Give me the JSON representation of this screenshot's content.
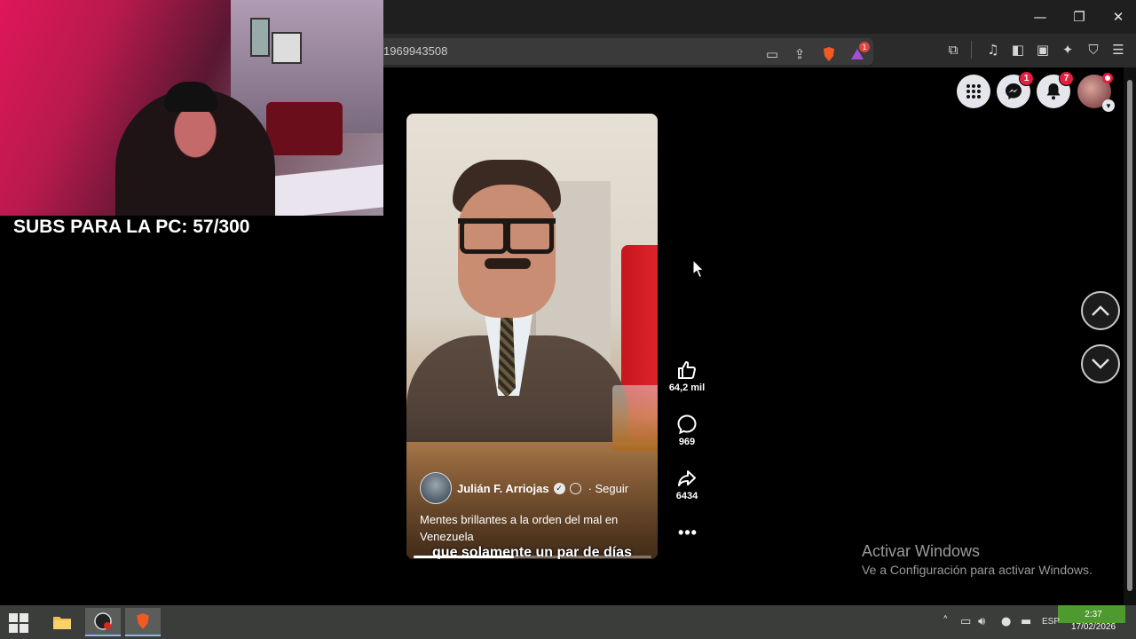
{
  "browser": {
    "url_fragment": "1969943508",
    "window_controls": {
      "minimize": "—",
      "maximize": "❐",
      "close": "✕"
    },
    "brave_badge": "1"
  },
  "facebook": {
    "messenger_badge": "1",
    "notifications_badge": "7"
  },
  "stream_overlay": {
    "subs_text": "SUBS PARA LA PC: 57/300"
  },
  "reel": {
    "caption": "que solamente un par de días",
    "author": "Julián F. Arriojas",
    "follow_label": "· Seguir",
    "description": "Mentes brillantes a la orden del mal en Venezuela",
    "progress": 0.42,
    "likes": "64,2 mil",
    "comments": "969",
    "shares": "6434"
  },
  "windows": {
    "activate_title": "Activar Windows",
    "activate_sub": "Ve a Configuración para activar Windows."
  },
  "taskbar": {
    "lang": "ESP",
    "time": "2:37",
    "date": "17/02/2026"
  }
}
